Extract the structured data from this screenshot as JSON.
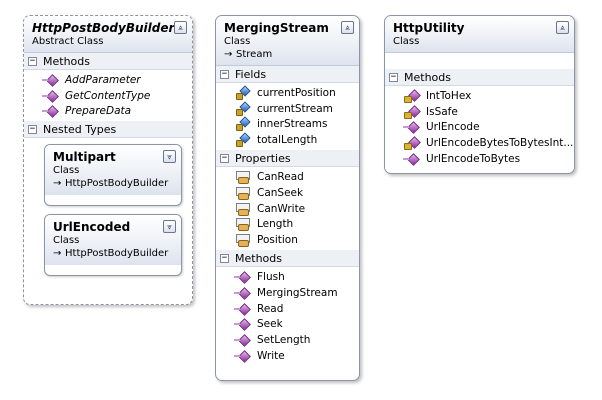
{
  "icons": {
    "collapse": "⩓",
    "expand": "⩔",
    "section_toggle": "−",
    "inherit_arrow": "→"
  },
  "classes": [
    {
      "name": "HttpPostBodyBuilder",
      "stereotype": "Abstract Class",
      "sections": [
        {
          "label": "Methods",
          "items": [
            {
              "name": "AddParameter",
              "kind": "method"
            },
            {
              "name": "GetContentType",
              "kind": "method"
            },
            {
              "name": "PrepareData",
              "kind": "method"
            }
          ]
        }
      ],
      "nested_label": "Nested Types",
      "nested": [
        {
          "name": "Multipart",
          "stereotype": "Class",
          "base": "HttpPostBodyBuilder"
        },
        {
          "name": "UrlEncoded",
          "stereotype": "Class",
          "base": "HttpPostBodyBuilder"
        }
      ]
    },
    {
      "name": "MergingStream",
      "stereotype": "Class",
      "base": "Stream",
      "sections": [
        {
          "label": "Fields",
          "items": [
            {
              "name": "currentPosition",
              "kind": "field"
            },
            {
              "name": "currentStream",
              "kind": "field"
            },
            {
              "name": "innerStreams",
              "kind": "field"
            },
            {
              "name": "totalLength",
              "kind": "field"
            }
          ]
        },
        {
          "label": "Properties",
          "items": [
            {
              "name": "CanRead",
              "kind": "property"
            },
            {
              "name": "CanSeek",
              "kind": "property"
            },
            {
              "name": "CanWrite",
              "kind": "property"
            },
            {
              "name": "Length",
              "kind": "property"
            },
            {
              "name": "Position",
              "kind": "property"
            }
          ]
        },
        {
          "label": "Methods",
          "items": [
            {
              "name": "Flush",
              "kind": "method"
            },
            {
              "name": "MergingStream",
              "kind": "method"
            },
            {
              "name": "Read",
              "kind": "method"
            },
            {
              "name": "Seek",
              "kind": "method"
            },
            {
              "name": "SetLength",
              "kind": "method"
            },
            {
              "name": "Write",
              "kind": "method"
            }
          ]
        }
      ]
    },
    {
      "name": "HttpUtility",
      "stereotype": "Class",
      "sections": [
        {
          "label": "Methods",
          "items": [
            {
              "name": "IntToHex",
              "kind": "method-private"
            },
            {
              "name": "IsSafe",
              "kind": "method-private"
            },
            {
              "name": "UrlEncode",
              "kind": "method"
            },
            {
              "name": "UrlEncodeBytesToBytesInt...",
              "kind": "method-private"
            },
            {
              "name": "UrlEncodeToBytes",
              "kind": "method"
            }
          ]
        }
      ]
    }
  ]
}
